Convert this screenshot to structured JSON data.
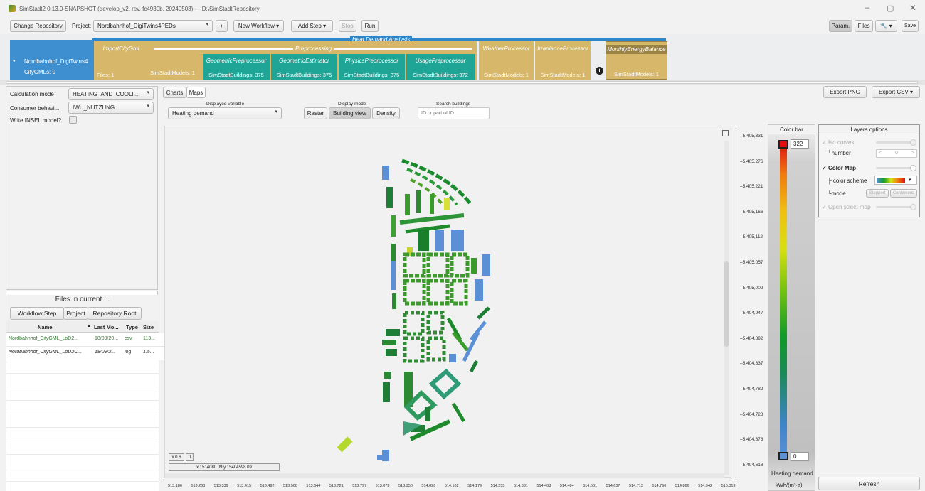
{
  "window": {
    "title": "SimStadt2 0.13.0-SNAPSHOT (develop_v2, rev. fc4930b, 20240503)  —  D:\\SimStadtRepository"
  },
  "toolbar": {
    "change_repo": "Change Repository",
    "project_label": "Project:",
    "project_value": "Nordbahnhof_DigiTwins4PEDs",
    "plus": "+",
    "new_workflow": "New Workflow",
    "add_step": "Add Step",
    "stop": "Stop",
    "run": "Run",
    "param": "Param.",
    "files": "Files",
    "save": "Save"
  },
  "workflow": {
    "title": "Heat Demand Analysis",
    "preprocessing": "Preprocessing",
    "source": {
      "name": "Nordbahnhof_DigiTwins4",
      "count": "CityGMLs: 0"
    },
    "steps": [
      {
        "title": "ImportCityGml",
        "bottom": "Files: 1"
      },
      {
        "title": "GeometricPreprocessor",
        "bottom": "SimStadtBuildings: 375",
        "left": "SimStadtModels: 1"
      },
      {
        "title": "GeometricEstimator",
        "bottom": "SimStadtBuildings: 375"
      },
      {
        "title": "PhysicsPreprocessor",
        "bottom": "SimStadtBuildings: 375"
      },
      {
        "title": "UsagePreprocessor",
        "bottom": "SimStadtBuildings: 372"
      },
      {
        "title": "WeatherProcessor",
        "bottom": "SimStadtModels: 1"
      },
      {
        "title": "IrradianceProcessor",
        "bottom": "SimStadtModels: 1"
      },
      {
        "title": "MonthlyEnergyBalance",
        "bottom": "SimStadtModels: 1"
      }
    ]
  },
  "params": {
    "calc_mode_label": "Calculation mode",
    "calc_mode_value": "HEATING_AND_COOLI...",
    "consumer_label": "Consumer behavi...",
    "consumer_value": "IWU_NUTZUNG",
    "insel_label": "Write INSEL model?"
  },
  "files_panel": {
    "title": "Files in current ...",
    "tabs": [
      "Workflow Step",
      "Project",
      "Repository Root"
    ],
    "columns": [
      "Name",
      "Last Mo...",
      "Type",
      "Size"
    ],
    "rows": [
      {
        "name": "Nordbahnhof_CityGML_LoD2...",
        "date": "18/09/20...",
        "type": "csv",
        "size": "113..."
      },
      {
        "name": "Nordbahnhof_CityGML_LoD2C...",
        "date": "18/09/2...",
        "type": "log",
        "size": "1.5..."
      }
    ]
  },
  "map_view": {
    "tabs": [
      "Charts",
      "Maps"
    ],
    "displayed_variable_label": "Displayed variable",
    "displayed_variable_value": "Heating demand",
    "display_mode_label": "Display mode",
    "modes": [
      "Raster",
      "Building view",
      "Density"
    ],
    "search_label": "Search buildings",
    "search_placeholder": "ID or part of ID",
    "export_png": "Export PNG",
    "export_csv": "Export CSV",
    "zoom_value": "x 0.6",
    "zoom_btn": "0",
    "coordinate": "x : 514080.09   y : 5404598.09",
    "y_ticks": [
      "5,405,331",
      "5,405,276",
      "5,405,221",
      "5,405,166",
      "5,405,112",
      "5,405,057",
      "5,405,002",
      "5,404,947",
      "5,404,892",
      "5,404,837",
      "5,404,782",
      "5,404,728",
      "5,404,673",
      "5,404,618"
    ],
    "x_ticks": [
      "513,186",
      "513,263",
      "513,339",
      "513,415",
      "513,492",
      "513,568",
      "513,644",
      "513,721",
      "513,797",
      "513,873",
      "513,950",
      "514,026",
      "514,102",
      "514,179",
      "514,255",
      "514,331",
      "514,408",
      "514,484",
      "514,561",
      "514,637",
      "514,713",
      "514,790",
      "514,866",
      "514,942",
      "515,019"
    ]
  },
  "colorbar": {
    "title": "Color bar",
    "max": "322",
    "min": "0",
    "variable": "Heating demand",
    "unit": "kWh/(m²·a)",
    "refresh": "Refresh"
  },
  "layers": {
    "title": "Layers options",
    "iso_curves": "Iso curves",
    "number_label": "number",
    "number_value": "0",
    "color_map": "Color Map",
    "color_scheme": "color scheme",
    "mode_label": "mode",
    "stepped": "Stepped",
    "continuous": "Continuous",
    "open_street_map": "Open street map"
  }
}
